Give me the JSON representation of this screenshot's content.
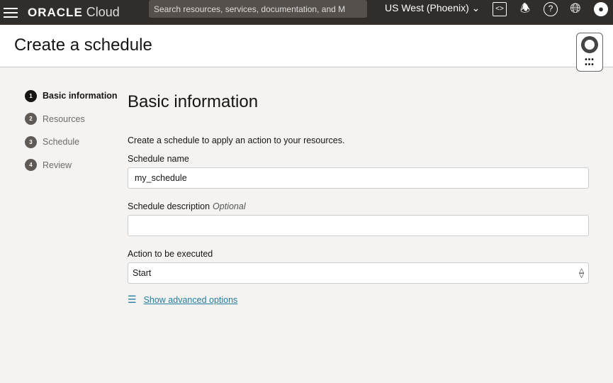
{
  "topbar": {
    "brand": "ORACLE",
    "brand_suffix": "Cloud",
    "search_placeholder": "Search resources, services, documentation, and M",
    "region": "US West (Phoenix)"
  },
  "header": {
    "title": "Create a schedule"
  },
  "steps": [
    {
      "num": "1",
      "label": "Basic information"
    },
    {
      "num": "2",
      "label": "Resources"
    },
    {
      "num": "3",
      "label": "Schedule"
    },
    {
      "num": "4",
      "label": "Review"
    }
  ],
  "form": {
    "title": "Basic information",
    "description": "Create a schedule to apply an action to your resources.",
    "name_label": "Schedule name",
    "name_value": "my_schedule",
    "desc_label": "Schedule description",
    "desc_optional": "Optional",
    "desc_value": "",
    "action_label": "Action to be executed",
    "action_value": "Start",
    "advanced_link": "Show advanced options"
  }
}
